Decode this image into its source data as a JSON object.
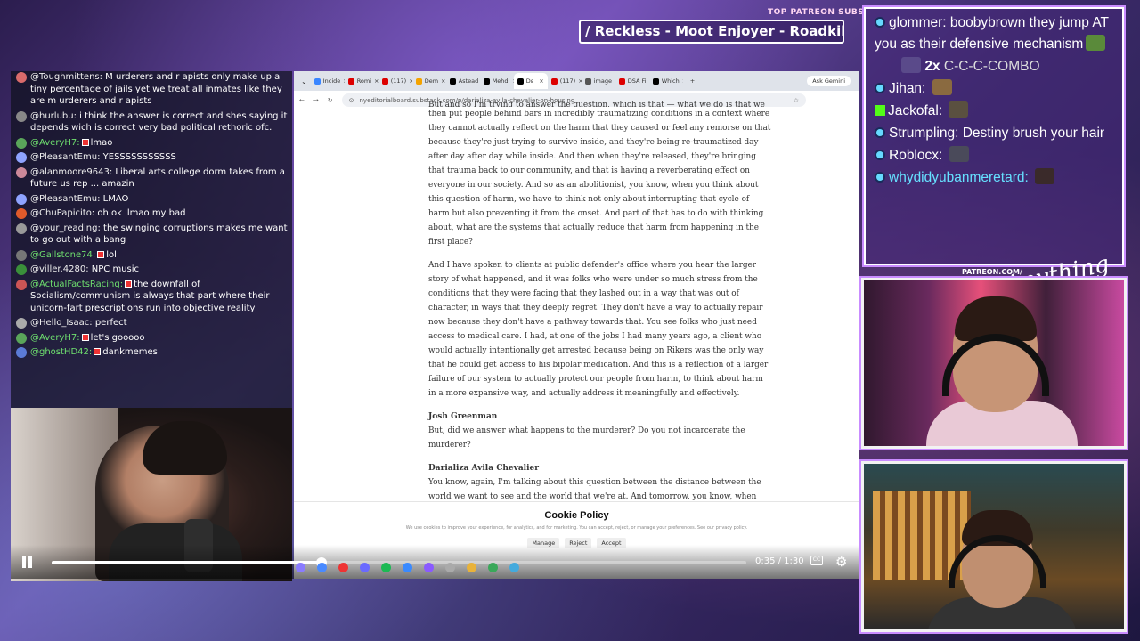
{
  "overlay": {
    "top_patreon_label": "TOP PATREON SUBS",
    "ticker_text": "/ Reckless - Moot Enjoyer - Roadkill - Jrbt",
    "patreon_sub_label": "PATREON.COM/",
    "signature": "Anything Else?"
  },
  "chat": [
    {
      "user": "@Toughmittens:",
      "text": "M urderers and r apists only make up a tiny percentage of jails yet we treat all inmates like they are m urderers and r apists",
      "color": "#d96b6b",
      "badge": false,
      "user_color": ""
    },
    {
      "user": "@hurlubu:",
      "text": "i think the answer is correct and shes saying it depends wich is correct very bad political rethoric ofc.",
      "color": "#888",
      "badge": false,
      "user_color": ""
    },
    {
      "user": "@AveryH7:",
      "text": "lmao",
      "color": "#5aa55a",
      "badge": true,
      "user_color": "green"
    },
    {
      "user": "@PleasantEmu:",
      "text": "YESSSSSSSSSSS",
      "color": "#8fa3ff",
      "badge": false,
      "user_color": ""
    },
    {
      "user": "@alanmoore9643:",
      "text": "Liberal arts college dorm takes from a future us rep ... amazin",
      "color": "#c89",
      "badge": false,
      "user_color": ""
    },
    {
      "user": "@PleasantEmu:",
      "text": "LMAO",
      "color": "#8fa3ff",
      "badge": false,
      "user_color": ""
    },
    {
      "user": "@ChuPapicito:",
      "text": "oh ok llmao my bad",
      "color": "#e05a2b",
      "badge": false,
      "user_color": ""
    },
    {
      "user": "@your_reading:",
      "text": "the swinging corruptions makes me want to go out with a bang",
      "color": "#999",
      "badge": false,
      "user_color": ""
    },
    {
      "user": "@Gallstone74:",
      "text": "lol",
      "color": "#777",
      "badge": true,
      "user_color": "green"
    },
    {
      "user": "@viller.4280:",
      "text": "NPC music",
      "color": "#3a8f3a",
      "badge": false,
      "user_color": ""
    },
    {
      "user": "@ActualFactsRacing:",
      "text": "the downfall of Socialism/communism is always that part where their unicorn-fart prescriptions run into objective reality",
      "color": "#c55",
      "badge": true,
      "user_color": "green"
    },
    {
      "user": "@Hello_Isaac:",
      "text": "perfect",
      "color": "#aaa",
      "badge": false,
      "user_color": ""
    },
    {
      "user": "@AveryH7:",
      "text": "let's gooooo",
      "color": "#5aa55a",
      "badge": true,
      "user_color": "green"
    },
    {
      "user": "@ghostHD42:",
      "text": "dankmemes",
      "color": "#5b7bd6",
      "badge": true,
      "user_color": "green"
    }
  ],
  "browser": {
    "tabs": [
      {
        "label": "Incide",
        "color": "#3a86ff"
      },
      {
        "label": "Romi",
        "color": "#d00"
      },
      {
        "label": "(117)",
        "color": "#d00"
      },
      {
        "label": "Dem",
        "color": "#f4a300"
      },
      {
        "label": "Astead",
        "color": "#000"
      },
      {
        "label": "Mehdi",
        "color": "#000"
      },
      {
        "label": "Dε",
        "color": "#000",
        "active": true
      },
      {
        "label": "(117)",
        "color": "#d00"
      },
      {
        "label": "image",
        "color": "#555"
      },
      {
        "label": "DSA Fi",
        "color": "#d00"
      },
      {
        "label": "Which",
        "color": "#000"
      }
    ],
    "ask_gemini": "Ask Gemini",
    "url": "nyeditorialboard.substack.com/p/darializa-avila-chevalier-on-housing"
  },
  "article": {
    "partial_top": "But and so I'm trying to answer the question, which is that — what we do is that we",
    "para1": "then put people behind bars in incredibly traumatizing conditions in a context where they cannot actually reflect on the harm that they caused or feel any remorse on that because they're just trying to survive inside, and they're being re-traumatized day after day after day while inside. And then when they're released, they're bringing that trauma back to our community, and that is having a reverberating effect on everyone in our society. And so as an abolitionist, you know, when you think about this question of harm, we have to think not only about interrupting that cycle of harm but also preventing it from the onset. And part of that has to do with thinking about, what are the systems that actually reduce that harm from happening in the first place?",
    "para2": "And I have spoken to clients at public defender's office where you hear the larger story of what happened, and it was folks who were under so much stress from the conditions that they were facing that they lashed out in a way that was out of character, in ways that they deeply regret. They don't have a way to actually repair now because they don't have a pathway towards that. You see folks who just need access to medical care. I had, at one of the jobs I had many years ago, a client who would actually intentionally get arrested because being on Rikers was the only way that he could get access to his bipolar medication. And this is a reflection of a larger failure of our system to actually protect our people from harm, to think about harm in a more expansive way, and actually address it meaningfully and effectively.",
    "speaker1": "Josh Greenman",
    "para3": "But, did we answer what happens to the murderer? Do you not incarcerate the murderer?",
    "speaker2": "Darializa Avila Chevalier",
    "para4": "You know, again, I'm talking about this question between the distance between the world we want to see and the world that we're at. And tomorrow, you know, when that"
  },
  "cookie": {
    "title": "Cookie Policy",
    "desc": "We use cookies to improve your experience, for analytics, and for marketing. You can accept, reject, or manage your preferences. See our privacy policy.",
    "manage": "Manage",
    "reject": "Reject",
    "accept": "Accept"
  },
  "player": {
    "time": "0:35 / 1:30",
    "progress": 0.389,
    "cc": "CC"
  },
  "right_chat": [
    {
      "user": "glommer:",
      "text": "boobybrown they jump AT you as their defensive mechanism",
      "emote": "#5a8a3a"
    },
    {
      "user": "2x",
      "text": "C-C-C-COMBO",
      "combo": true
    },
    {
      "user": "Jihan:",
      "text": "",
      "emote": "#8a6a40"
    },
    {
      "user": "Jackofal:",
      "text": "",
      "emote": "#5a5040",
      "kick": true
    },
    {
      "user": "Strumpling:",
      "text": "Destiny brush your hair",
      "emote": ""
    },
    {
      "user": "Roblocx:",
      "text": "",
      "emote": "#4a4a5a"
    },
    {
      "user": "whydidyubanmeretard:",
      "text": "",
      "emote": "#3a2a2a",
      "cyan": true
    }
  ]
}
